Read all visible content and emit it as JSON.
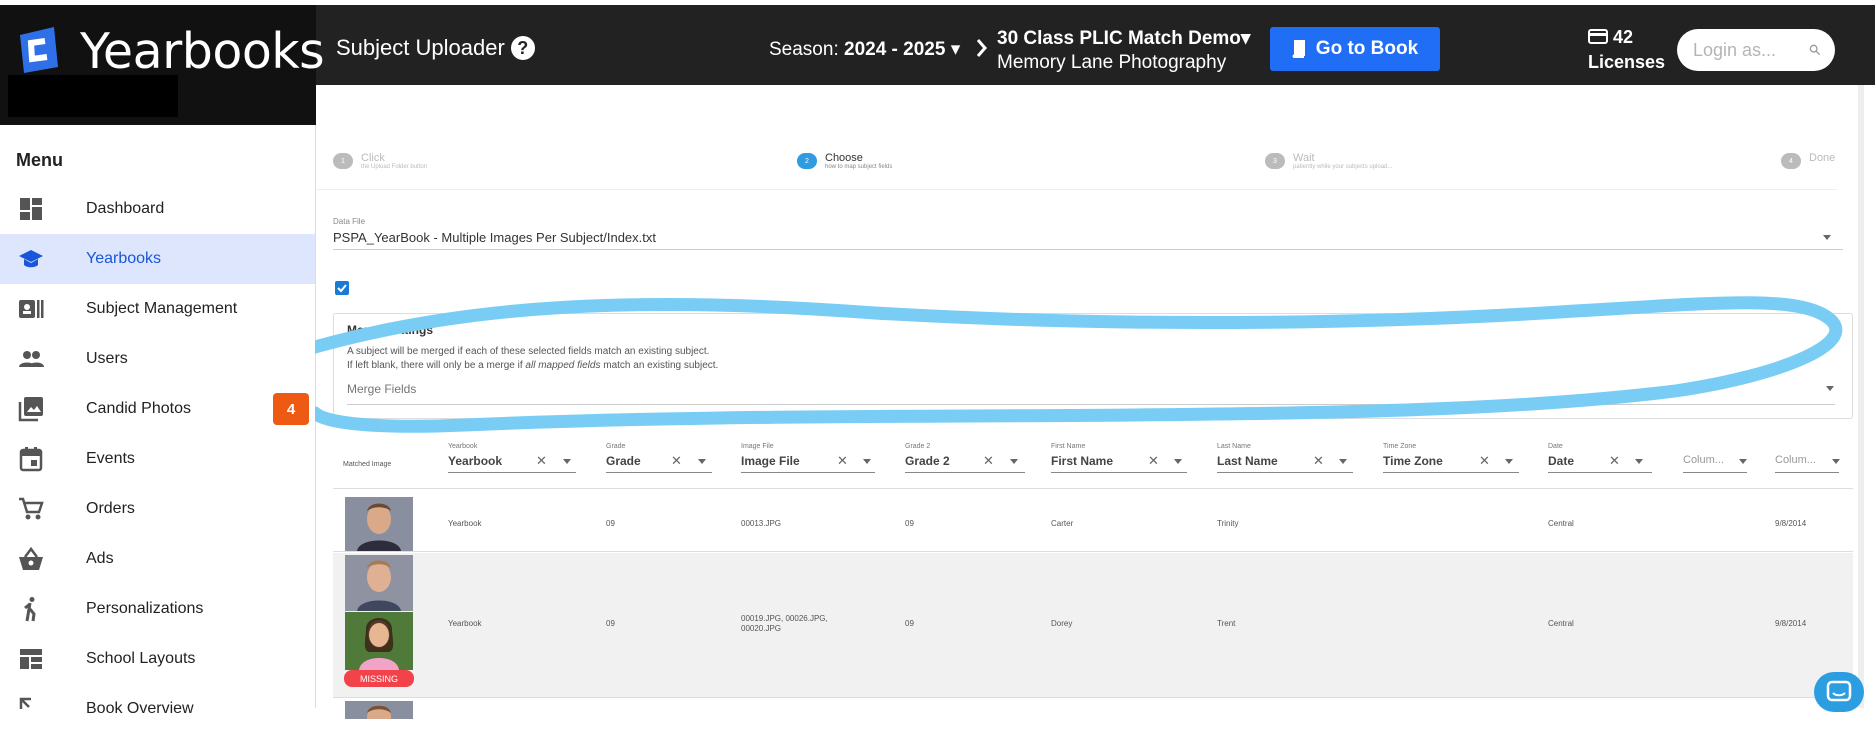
{
  "app": {
    "brand_name": "Yearbooks",
    "page_title": "Subject Uploader",
    "season_label": "Season:",
    "season_value": "2024 - 2025",
    "book_title": "30 Class PLIC Match Demo",
    "book_subtitle": "Memory Lane Photography",
    "goto_label": "Go to Book",
    "licenses_count": "42",
    "licenses_label": "Licenses",
    "login_placeholder": "Login as...",
    "accent_color": "#1f6ef5"
  },
  "sidebar": {
    "menu_label": "Menu",
    "items": [
      {
        "label": "Dashboard",
        "icon": "dashboard-icon"
      },
      {
        "label": "Yearbooks",
        "icon": "graduation-cap-icon",
        "active": true
      },
      {
        "label": "Subject Management",
        "icon": "id-card-icon"
      },
      {
        "label": "Users",
        "icon": "people-icon"
      },
      {
        "label": "Candid Photos",
        "icon": "photo-library-icon",
        "badge": "4"
      },
      {
        "label": "Events",
        "icon": "calendar-icon"
      },
      {
        "label": "Orders",
        "icon": "cart-icon"
      },
      {
        "label": "Ads",
        "icon": "basket-icon"
      },
      {
        "label": "Personalizations",
        "icon": "person-walking-icon"
      },
      {
        "label": "School Layouts",
        "icon": "layout-icon"
      },
      {
        "label": "Book Overview",
        "icon": "expand-icon"
      }
    ]
  },
  "stepper": {
    "steps": [
      {
        "num": "1",
        "title": "Click",
        "desc": "the Upload Folder button"
      },
      {
        "num": "2",
        "title": "Choose",
        "desc": "how to map subject fields",
        "active": true
      },
      {
        "num": "3",
        "title": "Wait",
        "desc": "patiently while your subjects upload..."
      },
      {
        "num": "4",
        "title": "Done",
        "desc": ""
      }
    ]
  },
  "datafile": {
    "label": "Data File",
    "value": "PSPA_YearBook - Multiple Images Per Subject/Index.txt"
  },
  "merge": {
    "title": "Merge Settings",
    "desc1": "A subject will be merged if each of these selected fields match an existing subject.",
    "desc2_pre": "If left blank, there will only be a merge if ",
    "desc2_em": "all mapped fields",
    "desc2_post": " match an existing subject.",
    "placeholder": "Merge Fields"
  },
  "table": {
    "matched_header": "Matched Image",
    "columns": [
      {
        "small": "Yearbook",
        "value": "Yearbook"
      },
      {
        "small": "Grade",
        "value": "Grade"
      },
      {
        "small": "Image File",
        "value": "Image File"
      },
      {
        "small": "Grade 2",
        "value": "Grade 2"
      },
      {
        "small": "First Name",
        "value": "First Name"
      },
      {
        "small": "Last Name",
        "value": "Last Name"
      },
      {
        "small": "Time Zone",
        "value": "Time Zone"
      },
      {
        "small": "Date",
        "value": "Date"
      },
      {
        "small": "",
        "value": "Colum..."
      },
      {
        "small": "",
        "value": "Colum..."
      }
    ],
    "rows": [
      {
        "yearbook": "Yearbook",
        "grade": "09",
        "image_file": "00013.JPG",
        "grade2": "09",
        "first": "Carter",
        "last": "Trinity",
        "tz": "",
        "date": "Central",
        "col9": "",
        "col10": "9/8/2014",
        "missing": false
      },
      {
        "yearbook": "Yearbook",
        "grade": "09",
        "image_file": "00019.JPG, 00026.JPG,",
        "image_file2": "00020.JPG",
        "grade2": "09",
        "first": "Dorey",
        "last": "Trent",
        "tz": "",
        "date": "Central",
        "col9": "",
        "col10": "9/8/2014",
        "missing": true,
        "missing_label": "MISSING"
      }
    ]
  }
}
